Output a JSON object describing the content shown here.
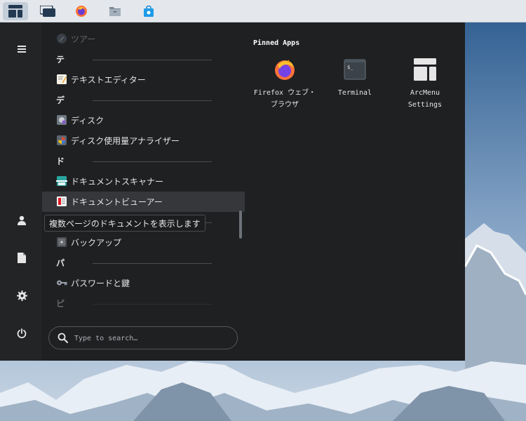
{
  "taskbar": {
    "items": [
      {
        "name": "arcmenu-launcher",
        "active": true
      },
      {
        "name": "show-desktop",
        "active": false
      },
      {
        "name": "firefox",
        "active": false
      },
      {
        "name": "files",
        "active": false
      },
      {
        "name": "software-store",
        "active": false
      }
    ]
  },
  "menu": {
    "app_list": {
      "top_partial": "ツアー",
      "groups": [
        {
          "header": "テ",
          "apps": [
            "テキストエディター"
          ]
        },
        {
          "header": "デ",
          "apps": [
            "ディスク",
            "ディスク使用量アナライザー"
          ]
        },
        {
          "header": "ド",
          "apps": [
            "ドキュメントスキャナー",
            "ドキュメントビューアー"
          ]
        },
        {
          "header": "",
          "apps": [
            "バックアップ"
          ]
        },
        {
          "header": "パ",
          "apps": [
            "パスワードと鍵"
          ]
        },
        {
          "header": "ピ",
          "apps": []
        }
      ]
    },
    "tooltip": "複数ページのドキュメントを表示します",
    "search": {
      "placeholder": "Type to search…"
    },
    "pinned": {
      "title": "Pinned Apps",
      "apps": [
        {
          "label": "Firefox ウェブ・ブラウザ",
          "icon": "firefox-icon"
        },
        {
          "label": "Terminal",
          "icon": "terminal-icon"
        },
        {
          "label": "ArcMenu Settings",
          "icon": "arcmenu-settings-icon"
        }
      ]
    }
  },
  "colors": {
    "menu_bg": "#1f2022",
    "selected_row": "#35373a",
    "taskbar_bg": "#e4e8ec"
  }
}
